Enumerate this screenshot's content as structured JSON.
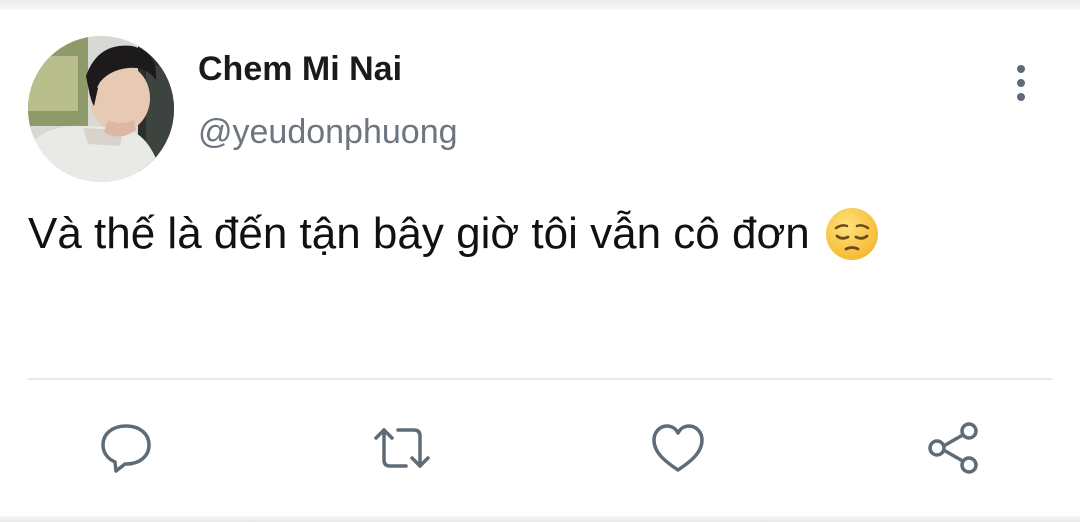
{
  "tweet": {
    "author": {
      "display_name": "Chem Mi Nai",
      "handle": "@yeudonphuong"
    },
    "text": "Và thế là đến tận bây giờ tôi vẫn cô đơn",
    "emoji": "pensive-face"
  },
  "actions": [
    {
      "name": "reply",
      "icon": "speech-bubble-icon"
    },
    {
      "name": "retweet",
      "icon": "retweet-icon"
    },
    {
      "name": "like",
      "icon": "heart-icon"
    },
    {
      "name": "share",
      "icon": "share-icon"
    }
  ],
  "colors": {
    "icon_gray": "#5f6b76",
    "handle_gray": "#6b7680",
    "text": "#111111"
  }
}
